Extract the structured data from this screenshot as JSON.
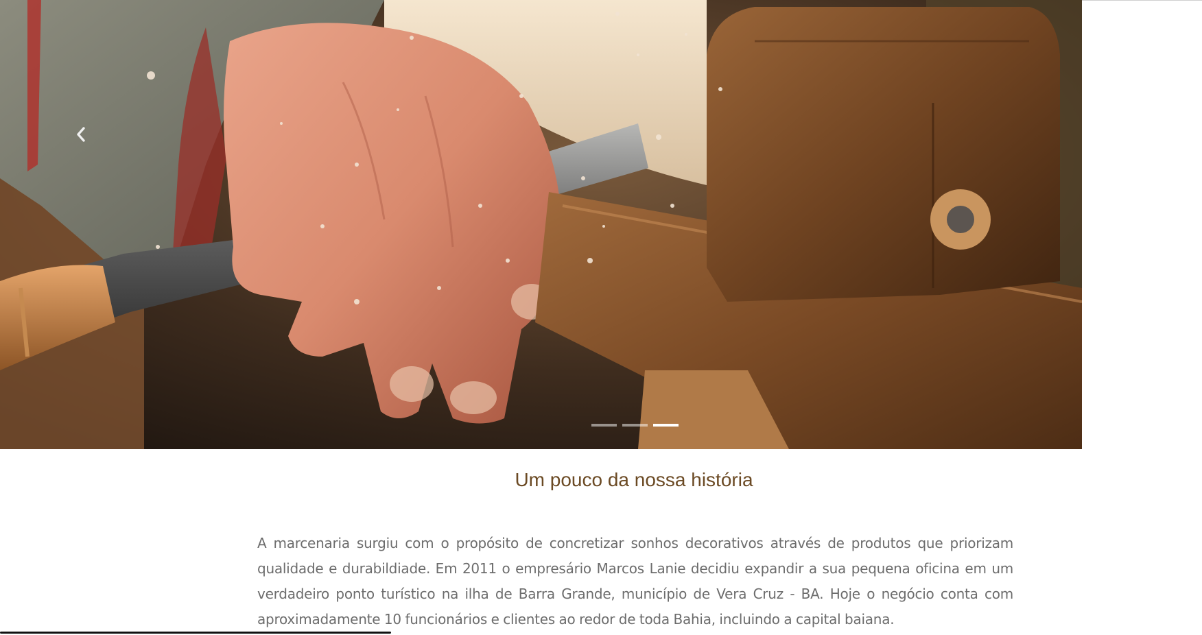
{
  "carousel": {
    "image_alt": "",
    "prev_icon": "chevron-left-icon",
    "slide_count": 3,
    "active_index": 2
  },
  "history": {
    "title": "Um pouco da nossa história",
    "paragraph": "A marcenaria surgiu com o propósito de concretizar sonhos decorativos através de produtos que priorizam qualidade e durabildiade. Em 2011 o empresário Marcos Lanie decidiu expandir a sua pequena oficina em um verdadeiro ponto turístico na ilha de Barra Grande, município de Vera Cruz - BA. Hoje o negócio conta com aproximadamente 10 funcionários e clientes ao redor de toda Bahia, incluindo a capital baiana."
  },
  "colors": {
    "title": "#6b4a24",
    "body_text": "#6c6c6c",
    "indicator_active": "#ffffff"
  }
}
